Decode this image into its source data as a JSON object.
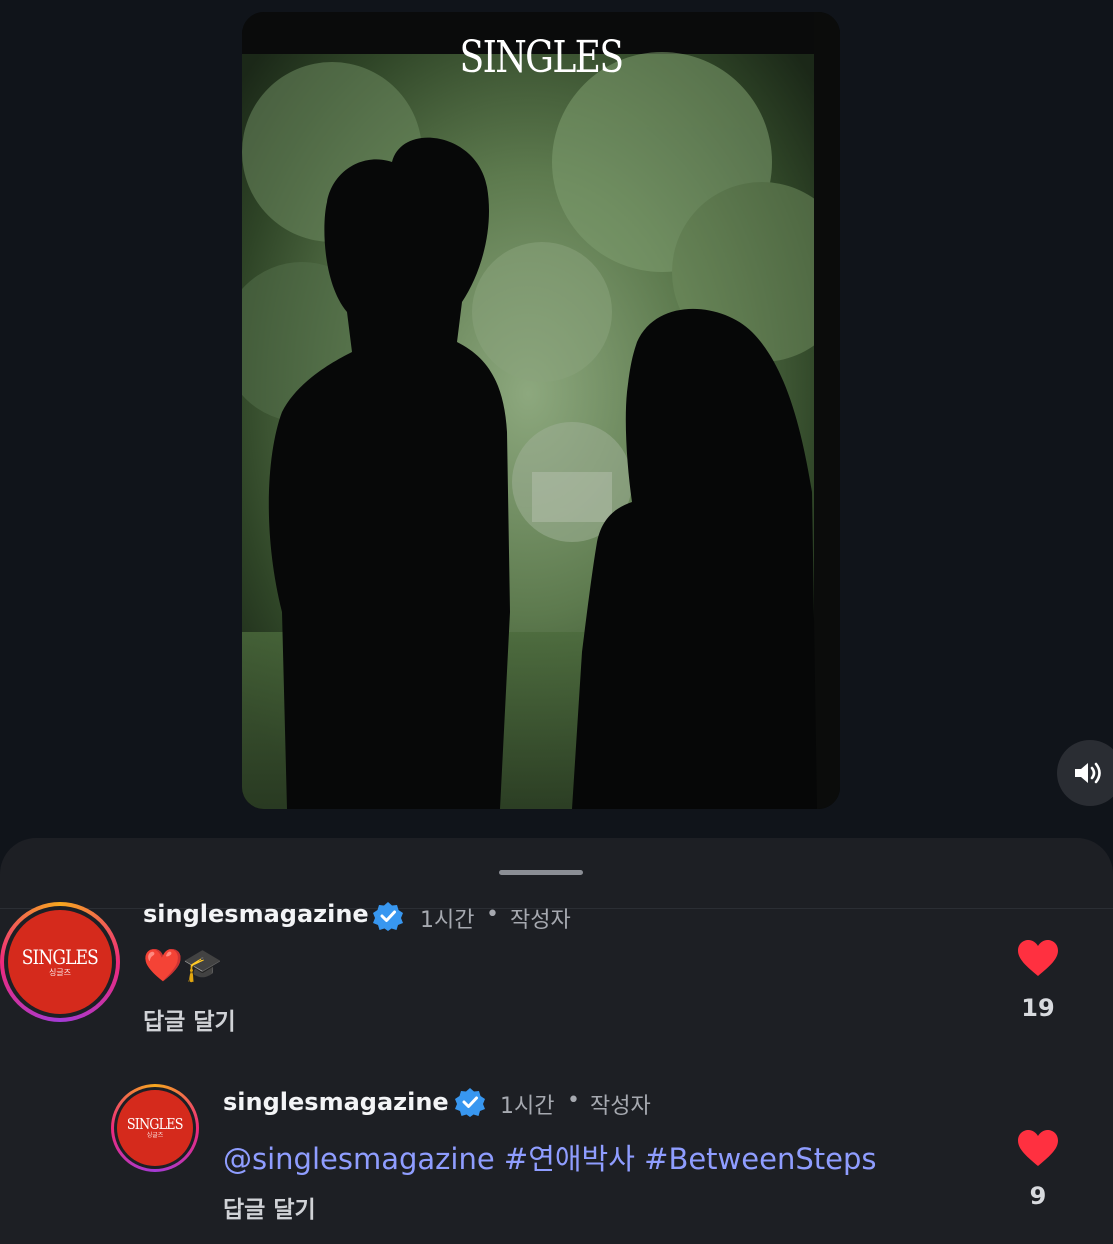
{
  "video": {
    "brand": "SINGLES",
    "sound_label": "sound"
  },
  "comments": [
    {
      "username": "singlesmagazine",
      "time": "1시간",
      "separator": "•",
      "author_badge": "작성자",
      "emojis": [
        "❤️",
        "🎓"
      ],
      "reply_label": "답글 달기",
      "like_count": "19",
      "avatar_logo": "SINGLES",
      "avatar_sub": "싱글즈"
    },
    {
      "username": "singlesmagazine",
      "time": "1시간",
      "separator": "•",
      "author_badge": "작성자",
      "mention": "@singlesmagazine",
      "hashtags": [
        "#연애박사",
        "#BetweenSteps"
      ],
      "reply_label": "답글 달기",
      "like_count": "9",
      "avatar_logo": "SINGLES",
      "avatar_sub": "싱글즈"
    }
  ],
  "colors": {
    "background": "#10141a",
    "sheet": "#1d1f24",
    "link": "#8f9dff",
    "like": "#ff3040",
    "verified": "#3897f0"
  }
}
